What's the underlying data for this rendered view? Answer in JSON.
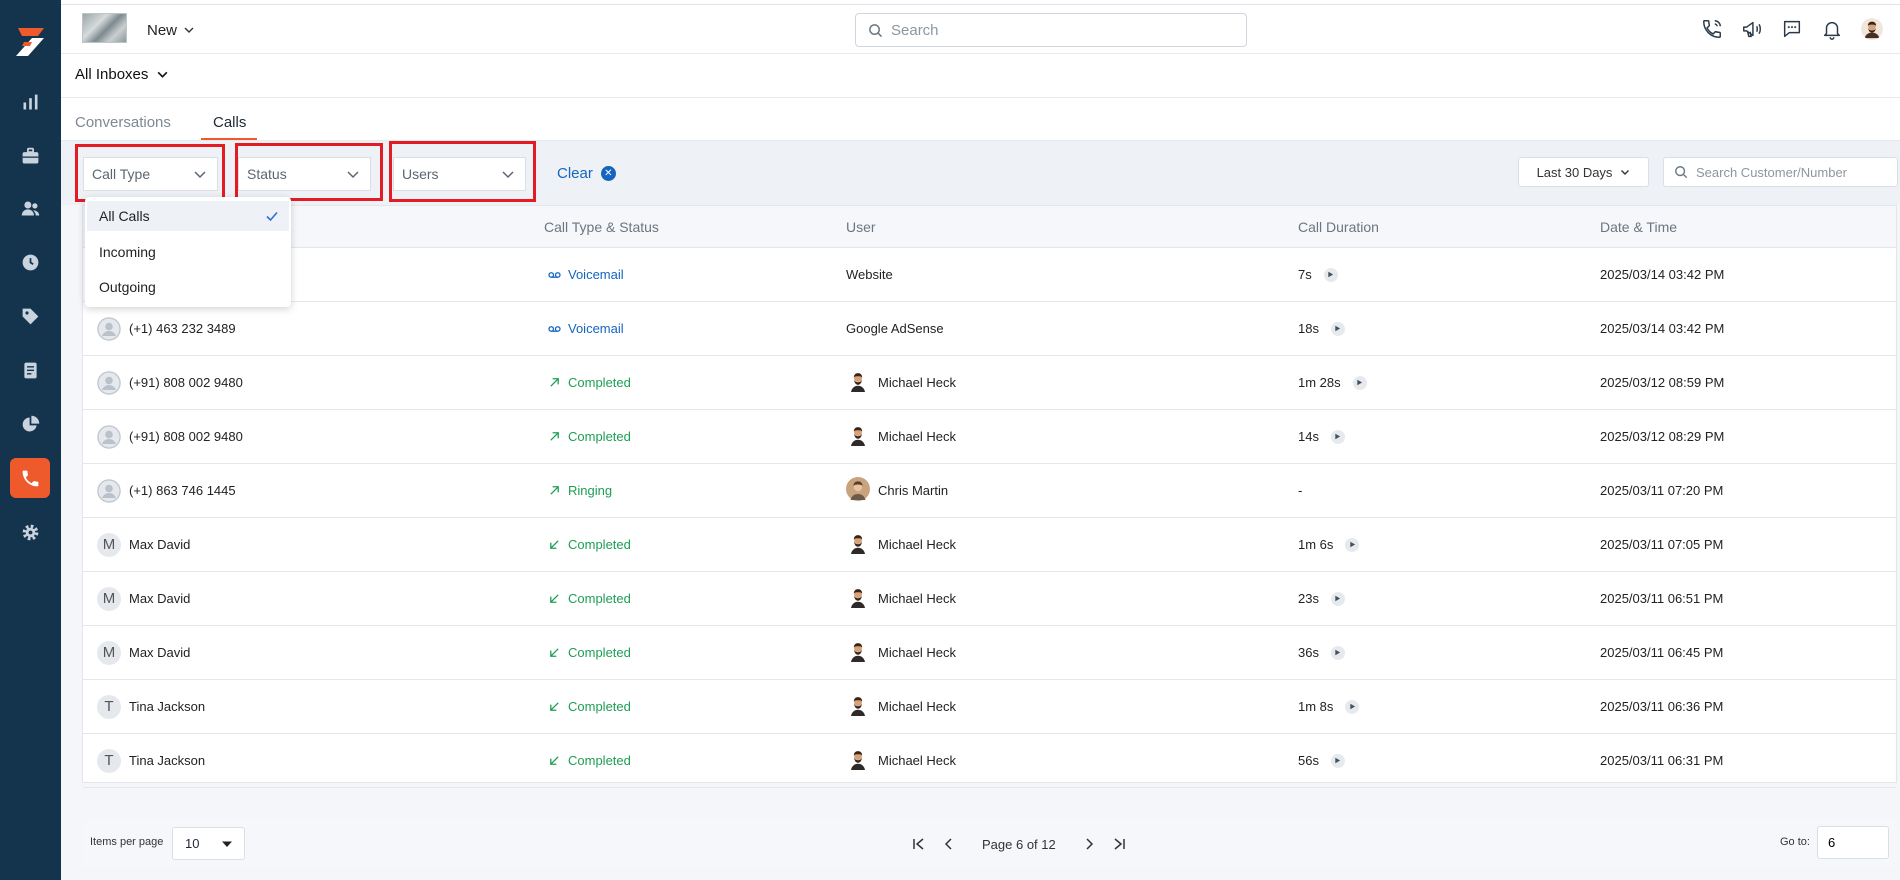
{
  "header": {
    "new_label": "New",
    "search_placeholder": "Search"
  },
  "inbox": {
    "label": "All Inboxes"
  },
  "tabs": [
    {
      "label": "Conversations"
    },
    {
      "label": "Calls"
    }
  ],
  "filters": {
    "call_type": "Call Type",
    "status": "Status",
    "users": "Users",
    "clear": "Clear",
    "date_range": "Last 30 Days",
    "customer_search_placeholder": "Search Customer/Number"
  },
  "dropdown": {
    "options": [
      "All Calls",
      "Incoming",
      "Outgoing"
    ],
    "selected": "All Calls"
  },
  "table": {
    "headers": [
      "Call Type & Status",
      "User",
      "Call Duration",
      "Date & Time"
    ],
    "rows": [
      {
        "customer": "",
        "avatar": "",
        "status": "Voicemail",
        "direction": "voicemail",
        "user": "Website",
        "user_avatar": "none",
        "duration": "7s",
        "playable": true,
        "datetime": "2025/03/14 03:42 PM"
      },
      {
        "customer": "(+1) 463 232 3489",
        "avatar": "person",
        "status": "Voicemail",
        "direction": "voicemail",
        "user": "Google AdSense",
        "user_avatar": "none",
        "duration": "18s",
        "playable": true,
        "datetime": "2025/03/14 03:42 PM"
      },
      {
        "customer": "(+91) 808 002 9480",
        "avatar": "person",
        "status": "Completed",
        "direction": "outgoing",
        "user": "Michael Heck",
        "user_avatar": "michael",
        "duration": "1m 28s",
        "playable": true,
        "datetime": "2025/03/12 08:59 PM"
      },
      {
        "customer": "(+91) 808 002 9480",
        "avatar": "person",
        "status": "Completed",
        "direction": "outgoing",
        "user": "Michael Heck",
        "user_avatar": "michael",
        "duration": "14s",
        "playable": true,
        "datetime": "2025/03/12 08:29 PM"
      },
      {
        "customer": "(+1) 863 746 1445",
        "avatar": "person",
        "status": "Ringing",
        "direction": "outgoing",
        "user": "Chris Martin",
        "user_avatar": "chris",
        "duration": "-",
        "playable": false,
        "datetime": "2025/03/11 07:20 PM"
      },
      {
        "customer": "Max David",
        "avatar": "M",
        "status": "Completed",
        "direction": "incoming",
        "user": "Michael Heck",
        "user_avatar": "michael",
        "duration": "1m 6s",
        "playable": true,
        "datetime": "2025/03/11 07:05 PM"
      },
      {
        "customer": "Max David",
        "avatar": "M",
        "status": "Completed",
        "direction": "incoming",
        "user": "Michael Heck",
        "user_avatar": "michael",
        "duration": "23s",
        "playable": true,
        "datetime": "2025/03/11 06:51 PM"
      },
      {
        "customer": "Max David",
        "avatar": "M",
        "status": "Completed",
        "direction": "incoming",
        "user": "Michael Heck",
        "user_avatar": "michael",
        "duration": "36s",
        "playable": true,
        "datetime": "2025/03/11 06:45 PM"
      },
      {
        "customer": "Tina Jackson",
        "avatar": "T",
        "status": "Completed",
        "direction": "incoming",
        "user": "Michael Heck",
        "user_avatar": "michael",
        "duration": "1m 8s",
        "playable": true,
        "datetime": "2025/03/11 06:36 PM"
      },
      {
        "customer": "Tina Jackson",
        "avatar": "T",
        "status": "Completed",
        "direction": "incoming",
        "user": "Michael Heck",
        "user_avatar": "michael",
        "duration": "56s",
        "playable": true,
        "datetime": "2025/03/11 06:31 PM"
      }
    ]
  },
  "footer": {
    "items_per_page_label": "Items per page",
    "items_per_page": "10",
    "page_text": "Page 6 of 12",
    "goto_label": "Go to:",
    "goto_value": "6"
  },
  "colors": {
    "sidebar": "#14334d",
    "accent": "#ee5a2b",
    "voicemail": "#1565c0",
    "completed": "#1e9e54",
    "highlight": "#e31b23"
  },
  "icons": {
    "sidebar": [
      "dashboard-chart-icon",
      "briefcase-icon",
      "contacts-icon",
      "clock-icon",
      "tag-icon",
      "document-icon",
      "pie-chart-icon",
      "phone-icon",
      "gear-icon"
    ],
    "header": [
      "phone-call-icon",
      "megaphone-icon",
      "chat-icon",
      "bell-icon",
      "user-avatar"
    ]
  }
}
